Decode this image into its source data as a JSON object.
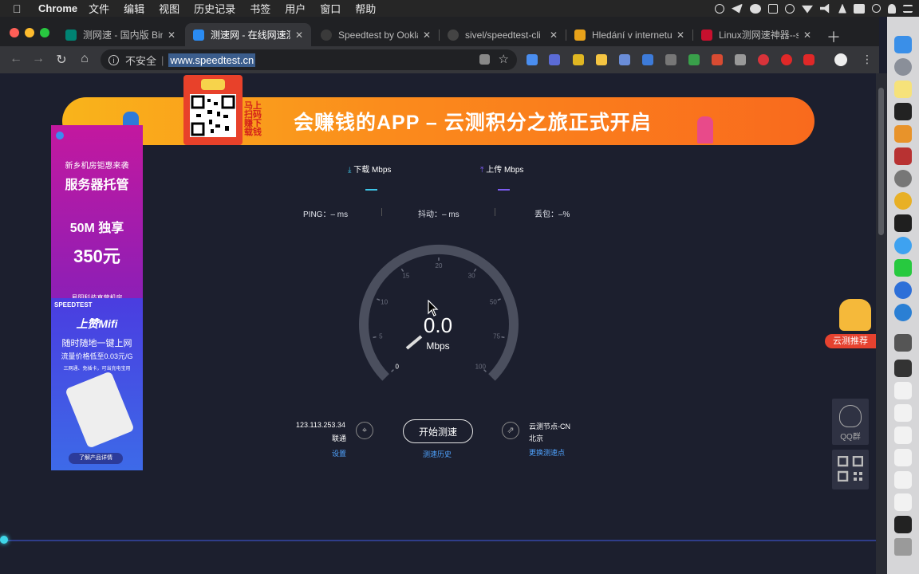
{
  "menubar": {
    "app_name": "Chrome",
    "items": [
      "文件",
      "编辑",
      "视图",
      "历史记录",
      "书签",
      "用户",
      "窗口",
      "帮助"
    ]
  },
  "tabs": [
    {
      "title": "测网速 - 国内版 Bing",
      "active": false,
      "favicon_color": "#008373"
    },
    {
      "title": "测速网 - 在线网速测试",
      "active": true,
      "favicon_color": "#2a8bf2"
    },
    {
      "title": "Speedtest by Ookla",
      "active": false,
      "favicon_color": "#3a3a3a"
    },
    {
      "title": "sivel/speedtest-cli",
      "active": false,
      "favicon_color": "#444"
    },
    {
      "title": "Hledání v internetu",
      "active": false,
      "favicon_color": "#e8a21a"
    },
    {
      "title": "Linux测网速神器--sp",
      "active": false,
      "favicon_color": "#c8102e"
    }
  ],
  "omnibox": {
    "security_label": "不安全",
    "url": "www.speedtest.cn"
  },
  "banner": {
    "headline": "会赚钱的APP – 云测积分之旅正式开启",
    "scan_text": "马上扫码赚下载钱"
  },
  "left_ad_1": {
    "line1": "新乡机房钜惠来袭",
    "line2": "服务器托管",
    "line3": "50M 独享",
    "price": "350元",
    "footer": "易阳科技直营机房"
  },
  "left_ad_2": {
    "brand": "SPEEDTEST",
    "product": "上赞Mifi",
    "line1": "随时随地一键上网",
    "line2": "流量价格低至0.03元/G",
    "line3": "三网通、免插卡，可当充电宝用",
    "button": "了解产品详情"
  },
  "speed": {
    "download_label": "下载 Mbps",
    "upload_label": "上传 Mbps",
    "ping_label": "PING：– ms",
    "jitter_label": "抖动：– ms",
    "loss_label": "丢包：–%",
    "value": "0.0",
    "unit": "Mbps",
    "gauge_ticks": [
      "0",
      "5",
      "10",
      "15",
      "20",
      "30",
      "50",
      "75",
      "100"
    ],
    "start_button": "开始测速",
    "history_link": "测速历史",
    "ip": "123.113.253.34",
    "isp": "联通",
    "settings_link": "设置",
    "server_name": "云测节点-CN",
    "server_city": "北京",
    "change_server_link": "更换测速点"
  },
  "side": {
    "qq_group": "QQ群",
    "recommend": "云测推荐"
  },
  "colors": {
    "page_bg": "#1c1f2e",
    "download_accent": "#3ec5e8",
    "upload_accent": "#7c5cf0",
    "link": "#4fa3ff",
    "gauge_track": "#4b4f5e"
  }
}
